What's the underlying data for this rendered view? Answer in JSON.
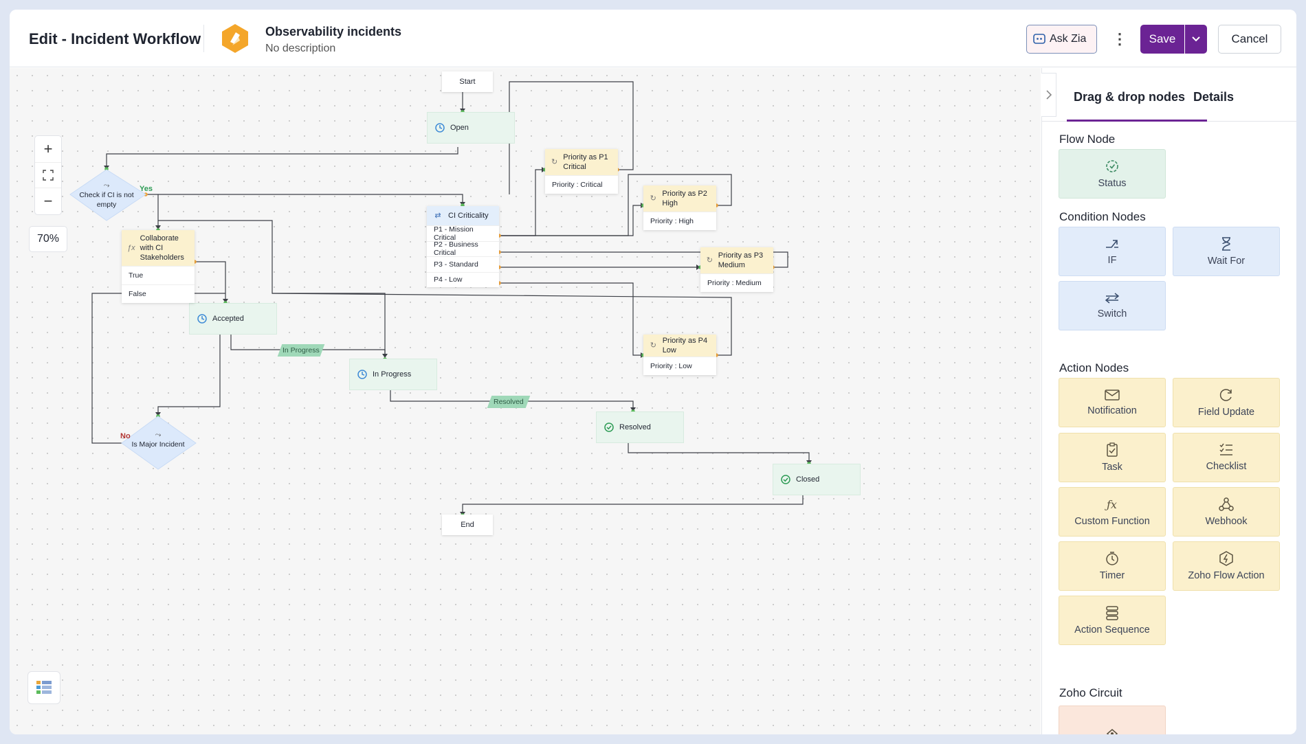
{
  "header": {
    "page_title": "Edit - Incident Workflow",
    "workflow_name": "Observability incidents",
    "workflow_description": "No description",
    "ask_zia_label": "Ask Zia",
    "save_label": "Save",
    "cancel_label": "Cancel"
  },
  "canvas": {
    "zoom_level": "70%",
    "nodes": {
      "start": "Start",
      "end": "End",
      "open": "Open",
      "accepted": "Accepted",
      "in_progress": "In Progress",
      "resolved": "Resolved",
      "closed": "Closed",
      "check_ci": "Check if CI is not empty",
      "is_major": "Is Major Incident",
      "collaborate": {
        "title": "Collaborate with CI Stakeholders",
        "rows": [
          "True",
          "False"
        ]
      },
      "ci_criticality": {
        "title": "CI Criticality",
        "rows": [
          "P1 - Mission Critical",
          "P2 - Business Critical",
          "P3 - Standard",
          "P4 - Low"
        ]
      },
      "p1": {
        "title": "Priority as P1 Critical",
        "value": "Priority : Critical"
      },
      "p2": {
        "title": "Priority as P2 High",
        "value": "Priority : High"
      },
      "p3": {
        "title": "Priority as P3 Medium",
        "value": "Priority : Medium"
      },
      "p4": {
        "title": "Priority as P4 Low",
        "value": "Priority : Low"
      }
    },
    "transitions": {
      "in_progress": "In Progress",
      "resolved": "Resolved"
    },
    "branch_labels": {
      "yes": "Yes",
      "no": "No"
    }
  },
  "panel": {
    "tabs": [
      "Drag & drop nodes",
      "Details"
    ],
    "active_tab": "Drag & drop nodes",
    "sections": {
      "flow": {
        "title": "Flow Node",
        "items": [
          "Status"
        ]
      },
      "condition": {
        "title": "Condition Nodes",
        "items": [
          "IF",
          "Wait For",
          "Switch"
        ]
      },
      "action": {
        "title": "Action Nodes",
        "items": [
          "Notification",
          "Field Update",
          "Task",
          "Checklist",
          "Custom Function",
          "Webhook",
          "Timer",
          "Zoho Flow Action",
          "Action Sequence"
        ]
      },
      "circuit": {
        "title": "Zoho Circuit"
      }
    }
  },
  "colors": {
    "accent": "#6b2394",
    "status_node": "#e9f5ee",
    "action_node": "#fbf1cf",
    "condition_node": "#e3eefb",
    "transition": "#9fd8b8"
  }
}
